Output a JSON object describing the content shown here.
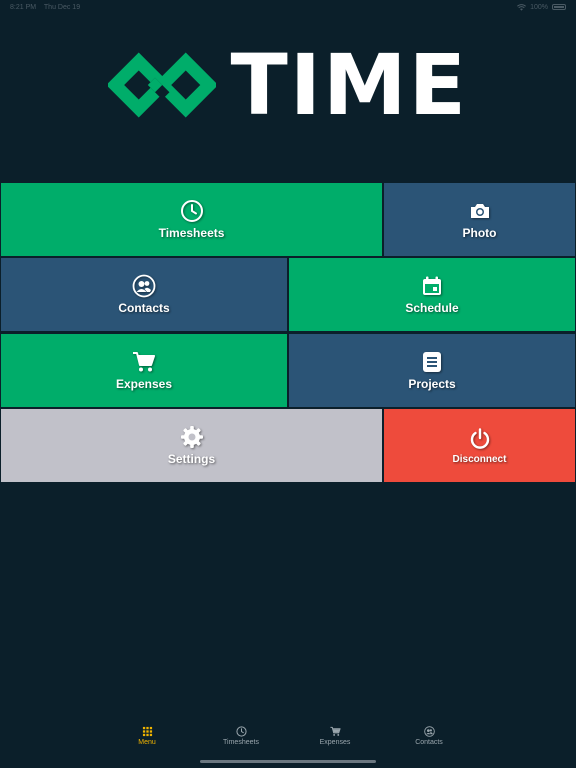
{
  "status_bar": {
    "time": "8:21 PM",
    "date": "Thu Dec 19",
    "battery": "100%"
  },
  "logo": {
    "text": "TIME",
    "brand_color": "#00ad6a"
  },
  "tiles": {
    "timesheets": {
      "label": "Timesheets",
      "icon": "clock-icon",
      "color": "#00ad6a"
    },
    "photo": {
      "label": "Photo",
      "icon": "camera-icon",
      "color": "#2b5476"
    },
    "contacts": {
      "label": "Contacts",
      "icon": "contacts-icon",
      "color": "#2b5476"
    },
    "schedule": {
      "label": "Schedule",
      "icon": "calendar-icon",
      "color": "#00ad6a"
    },
    "expenses": {
      "label": "Expenses",
      "icon": "cart-icon",
      "color": "#00ad6a"
    },
    "projects": {
      "label": "Projects",
      "icon": "document-icon",
      "color": "#2b5476"
    },
    "settings": {
      "label": "Settings",
      "icon": "gear-icon",
      "color": "#c1c1c9"
    },
    "disconnect": {
      "label": "Disconnect",
      "icon": "power-icon",
      "color": "#ee4b3c"
    }
  },
  "tabbar": {
    "items": [
      {
        "label": "Menu",
        "icon": "grid-icon",
        "active": true
      },
      {
        "label": "Timesheets",
        "icon": "clock-icon",
        "active": false
      },
      {
        "label": "Expenses",
        "icon": "cart-icon",
        "active": false
      },
      {
        "label": "Contacts",
        "icon": "contacts-icon",
        "active": false
      }
    ],
    "active_color": "#f0b400"
  }
}
